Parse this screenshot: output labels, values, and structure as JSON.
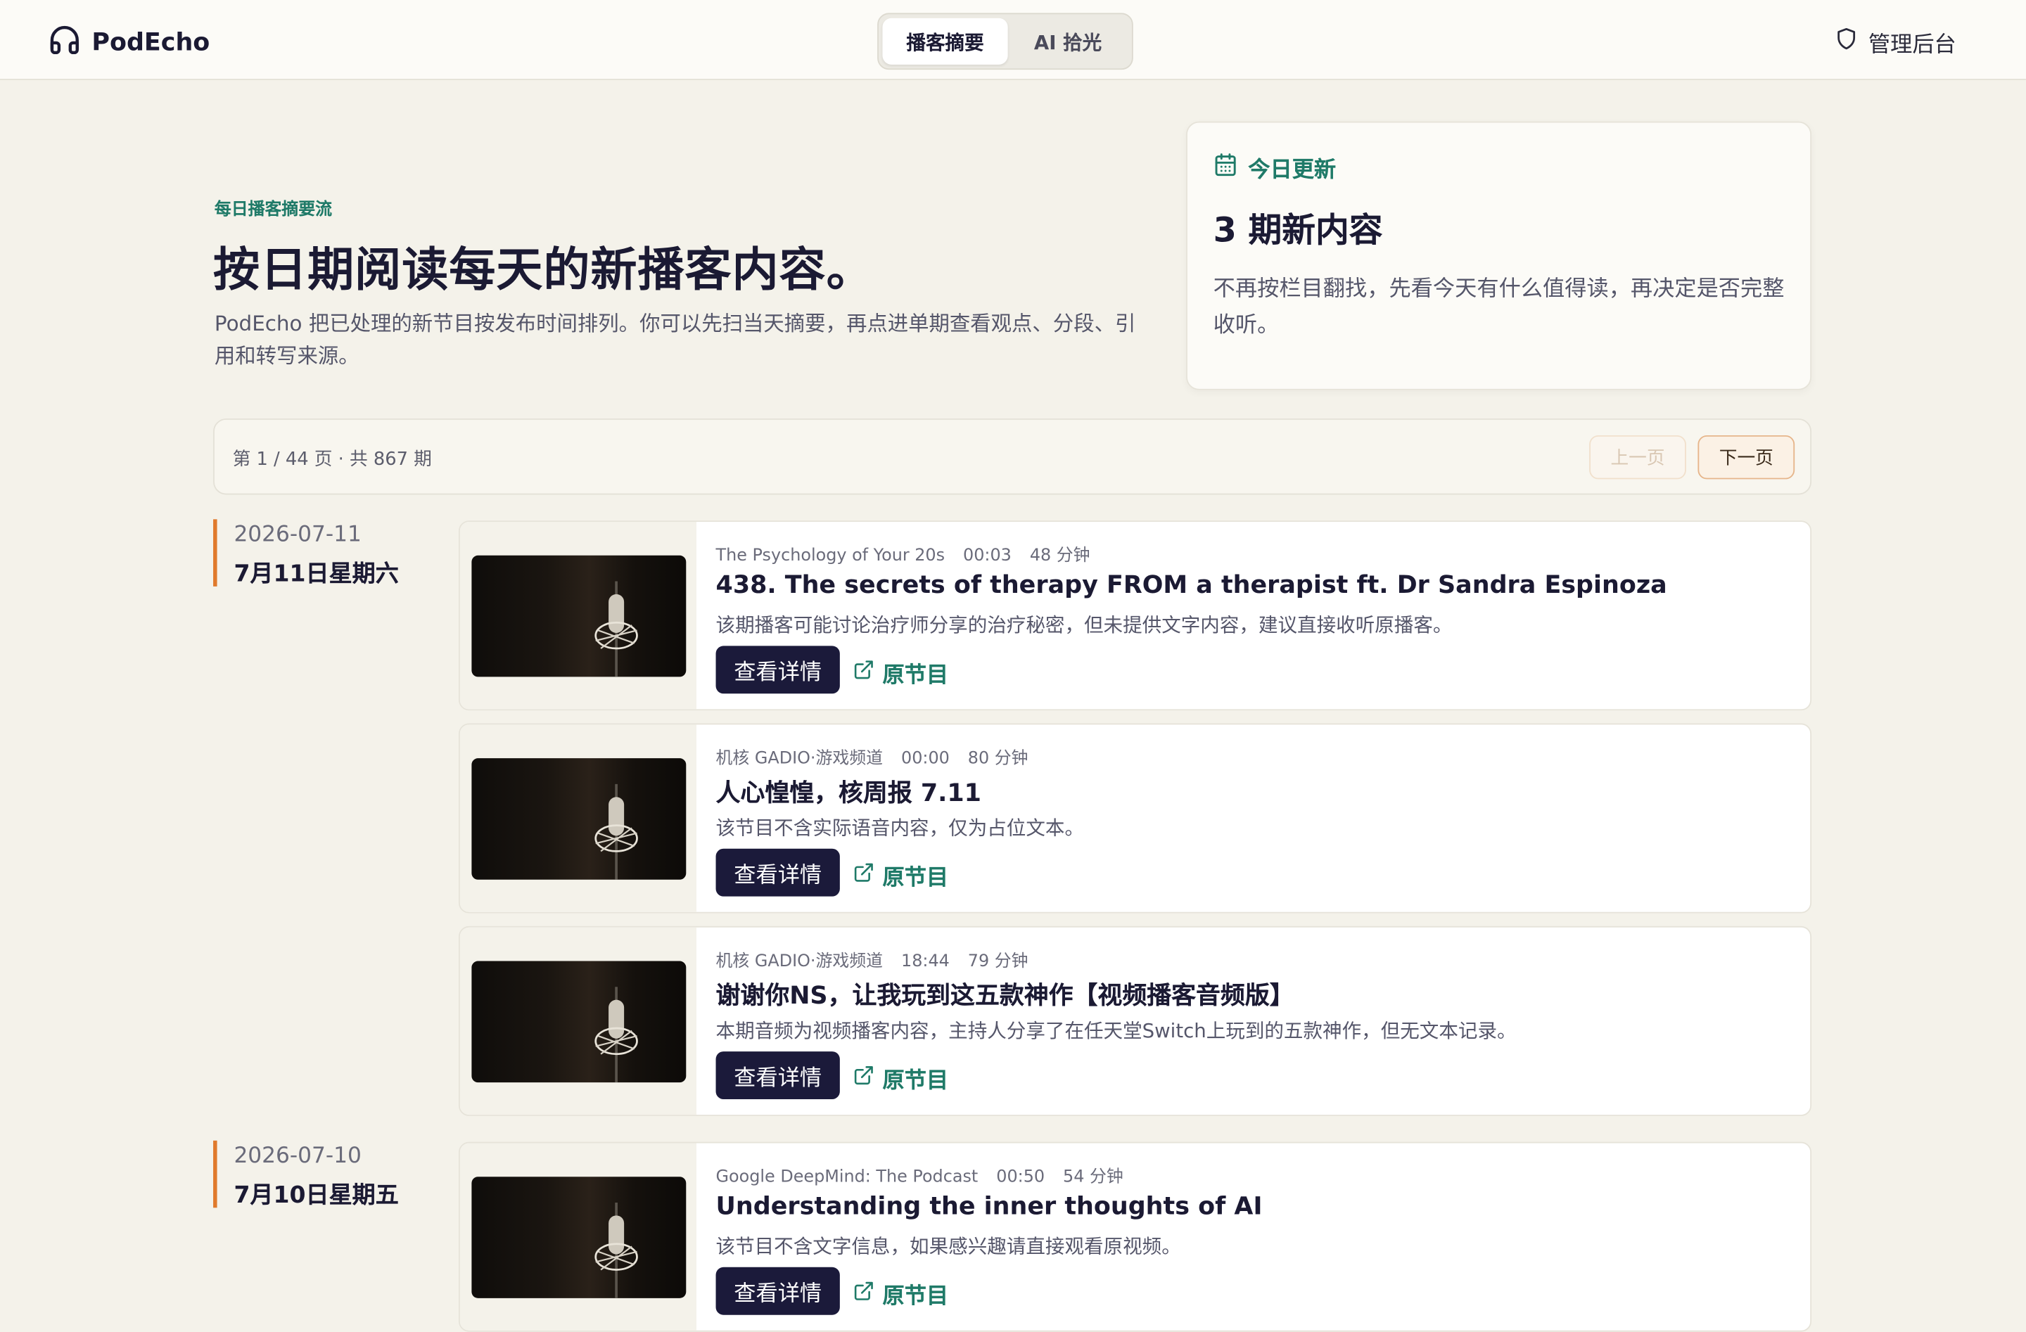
{
  "header": {
    "brand": "PodEcho",
    "tabs": [
      {
        "label": "播客摘要",
        "active": true
      },
      {
        "label": "AI 拾光",
        "active": false
      }
    ],
    "admin_label": "管理后台"
  },
  "hero": {
    "eyebrow": "每日播客摘要流",
    "title": "按日期阅读每天的新播客内容。",
    "description": "PodEcho 把已处理的新节目按发布时间排列。你可以先扫当天摘要，再点进单期查看观点、分段、引用和转写来源。"
  },
  "today": {
    "label": "今日更新",
    "count_text": "3 期新内容",
    "description": "不再按栏目翻找，先看今天有什么值得读，再决定是否完整收听。"
  },
  "pager": {
    "info": "第 1 / 44 页 · 共 867 期",
    "prev_label": "上一页",
    "next_label": "下一页"
  },
  "groups": [
    {
      "date_iso": "2026-07-11",
      "date_cn": "7月11日星期六",
      "episodes": [
        {
          "show": "The Psychology of Your 20s",
          "time": "00:03",
          "duration": "48 分钟",
          "title": "438. The secrets of therapy FROM a therapist ft. Dr Sandra Espinoza",
          "summary": "该期播客可能讨论治疗师分享的治疗秘密，但未提供文字内容，建议直接收听原播客。",
          "detail_label": "查看详情",
          "source_label": "原节目"
        },
        {
          "show": "机核 GADIO·游戏频道",
          "time": "00:00",
          "duration": "80 分钟",
          "title": "人心惶惶，核周报 7.11",
          "summary": "该节目不含实际语音内容，仅为占位文本。",
          "detail_label": "查看详情",
          "source_label": "原节目"
        },
        {
          "show": "机核 GADIO·游戏频道",
          "time": "18:44",
          "duration": "79 分钟",
          "title": "谢谢你NS，让我玩到这五款神作【视频播客音频版】",
          "summary": "本期音频为视频播客内容，主持人分享了在任天堂Switch上玩到的五款神作，但无文本记录。",
          "detail_label": "查看详情",
          "source_label": "原节目"
        }
      ]
    },
    {
      "date_iso": "2026-07-10",
      "date_cn": "7月10日星期五",
      "episodes": [
        {
          "show": "Google DeepMind: The Podcast",
          "time": "00:50",
          "duration": "54 分钟",
          "title": "Understanding the inner thoughts of AI",
          "summary": "该节目不含文字信息，如果感兴趣请直接观看原视频。",
          "detail_label": "查看详情",
          "source_label": "原节目"
        }
      ]
    }
  ],
  "colors": {
    "accent_green": "#1f7a68",
    "accent_orange": "#e07a2c",
    "button_dark": "#1b1a3a",
    "page_bg": "#f4f2ea"
  }
}
